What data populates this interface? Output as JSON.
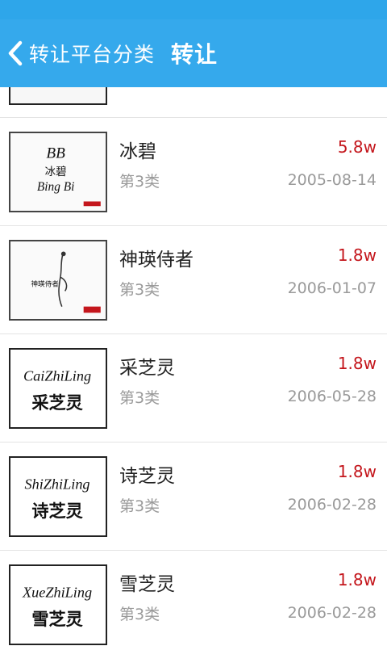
{
  "header": {
    "back_label": "转让平台分类",
    "title": "转让"
  },
  "items": [
    {
      "name": "冰碧",
      "category": "第3类",
      "price": "5.8w",
      "date": "2005-08-14",
      "logo": {
        "line1": "BB",
        "line2": "冰碧",
        "line3": "Bing Bi"
      }
    },
    {
      "name": "神瑛侍者",
      "category": "第3类",
      "price": "1.8w",
      "date": "2006-01-07",
      "logo": {
        "line1": "神瑛侍者"
      }
    },
    {
      "name": "采芝灵",
      "category": "第3类",
      "price": "1.8w",
      "date": "2006-05-28",
      "logo": {
        "line1": "CaiZhiLing",
        "line2": "采芝灵"
      }
    },
    {
      "name": "诗芝灵",
      "category": "第3类",
      "price": "1.8w",
      "date": "2006-02-28",
      "logo": {
        "line1": "ShiZhiLing",
        "line2": "诗芝灵"
      }
    },
    {
      "name": "雪芝灵",
      "category": "第3类",
      "price": "1.8w",
      "date": "2006-02-28",
      "logo": {
        "line1": "XueZhiLing",
        "line2": "雪芝灵"
      }
    }
  ]
}
